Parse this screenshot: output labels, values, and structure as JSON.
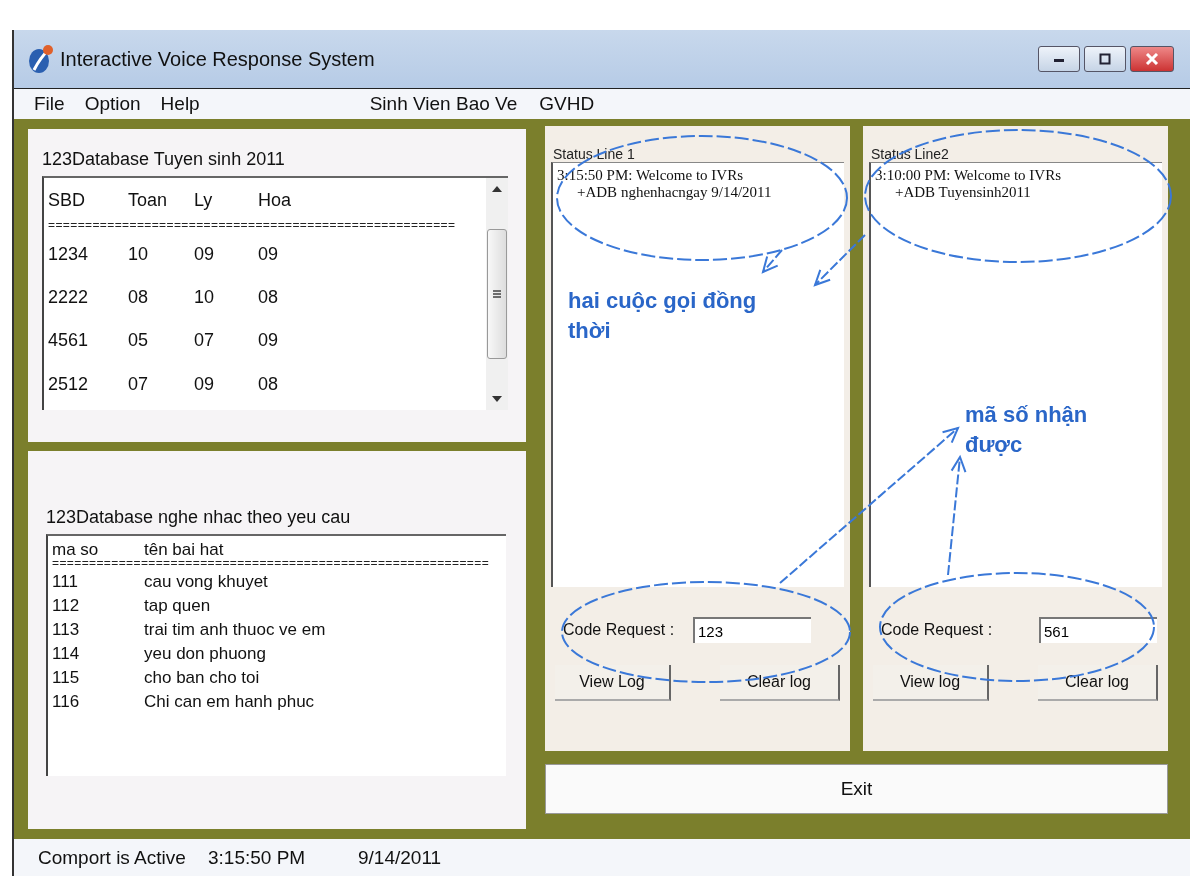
{
  "window": {
    "title": "Interactive Voice Response System"
  },
  "menu": [
    "File",
    "Option",
    "Help"
  ],
  "menu_right": [
    "Sinh Vien Bao Ve",
    "GVHD"
  ],
  "admissions": {
    "title": "123Database Tuyen sinh 2011",
    "columns": [
      "SBD",
      "Toan",
      "Ly",
      "Hoa"
    ],
    "separator": "=======================================================",
    "rows": [
      [
        "1234",
        "10",
        "09",
        "09"
      ],
      [
        "2222",
        "08",
        "10",
        "08"
      ],
      [
        "4561",
        "05",
        "07",
        "09"
      ],
      [
        "2512",
        "07",
        "09",
        "08"
      ]
    ]
  },
  "songs": {
    "title": "123Database nghe nhac theo yeu cau",
    "columns": [
      "ma so",
      "tên bai hat"
    ],
    "separator": "===========================================================",
    "rows": [
      [
        "111",
        "cau vong khuyet"
      ],
      [
        "112",
        "tap quen"
      ],
      [
        "113",
        "trai tim anh thuoc ve em"
      ],
      [
        "114",
        "yeu don phuong"
      ],
      [
        "115",
        "cho ban cho toi"
      ],
      [
        "116",
        "Chi can em hanh phuc"
      ]
    ]
  },
  "lines": [
    {
      "title": "Status Line 1",
      "log": [
        "3:15:50 PM: Welcome to IVRs",
        "+ADB nghenhacngay 9/14/2011"
      ],
      "code_label": "Code Request :",
      "code_value": "123",
      "buttons": [
        "View Log",
        "Clear log"
      ]
    },
    {
      "title": "Status Line2",
      "log": [
        "3:10:00 PM: Welcome to IVRs",
        "+ADB  Tuyensinh2011"
      ],
      "code_label": "Code Request :",
      "code_value": "561",
      "buttons": [
        "View log",
        "Clear log"
      ]
    }
  ],
  "exit_button": "Exit",
  "status_bar": [
    "Comport is Active",
    "3:15:50 PM",
    "9/14/2011"
  ],
  "annotations": [
    {
      "text": "hai cuộc gọi đồng thời"
    },
    {
      "text": "mã số nhận được"
    }
  ]
}
